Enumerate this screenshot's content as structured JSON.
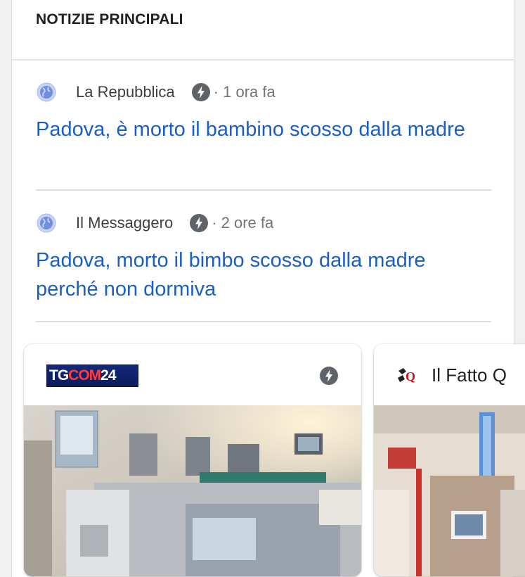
{
  "section": {
    "title": "NOTIZIE PRINCIPALI"
  },
  "stories": [
    {
      "source": "La Repubblica",
      "time": "· 1 ora fa",
      "headline": "Padova, è morto il bambino scosso dalla madre"
    },
    {
      "source": "Il Messaggero",
      "time": "· 2 ore fa",
      "headline": "Padova, morto il bimbo scosso dalla madre perché non dormiva"
    }
  ],
  "carousel": [
    {
      "source_logo_text": "TGCOM24",
      "logo_part1": "TG",
      "logo_part2": "COM",
      "logo_part3": "24",
      "icon": "amp-lightning-icon",
      "image": "hospital-incubator-photo"
    },
    {
      "source": "Il Fatto Q",
      "icon": "ifq-logo",
      "image": "hospital-corridor-photo"
    }
  ],
  "colors": {
    "link": "#1a5fc8",
    "amp_badge": "#5f6368",
    "card_bg": "#ffffff",
    "page_bg": "#f1f1f1"
  }
}
